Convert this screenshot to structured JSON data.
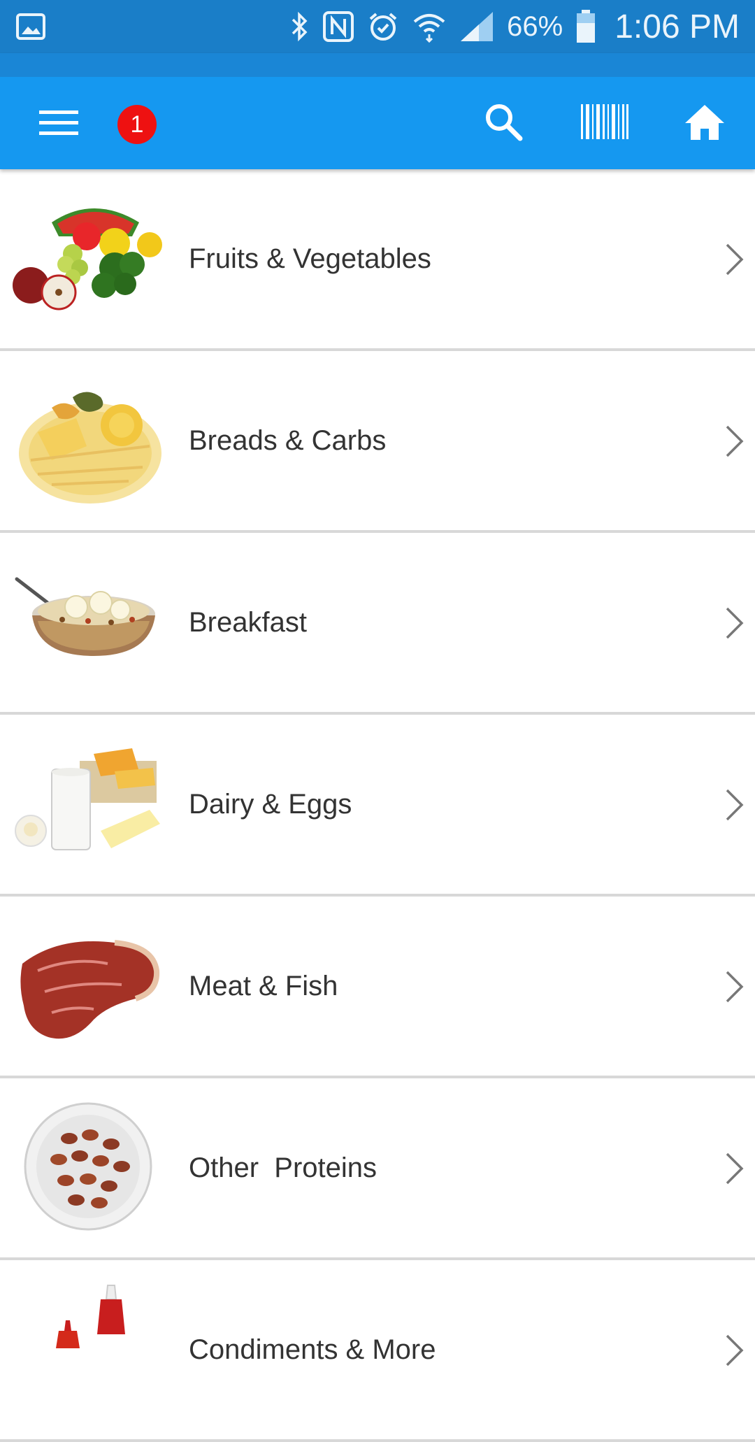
{
  "status_bar": {
    "battery": "66%",
    "time": "1:06 PM",
    "icons": [
      "gallery-icon",
      "bluetooth-icon",
      "nfc-icon",
      "alarm-icon",
      "wifi-icon",
      "signal-icon",
      "battery-icon"
    ]
  },
  "app_bar": {
    "notification_count": "1",
    "icons": [
      "menu-icon",
      "search-icon",
      "barcode-icon",
      "home-icon"
    ],
    "color": "#1598f0"
  },
  "categories": [
    {
      "label": "Fruits & Vegetables",
      "icon": "fruits-vegetables-image"
    },
    {
      "label": "Breads & Carbs",
      "icon": "breads-carbs-image"
    },
    {
      "label": "Breakfast",
      "icon": "breakfast-image"
    },
    {
      "label": "Dairy & Eggs",
      "icon": "dairy-eggs-image"
    },
    {
      "label": "Meat & Fish",
      "icon": "meat-fish-image"
    },
    {
      "label": "Other  Proteins",
      "icon": "other-proteins-image"
    },
    {
      "label": "Condiments & More",
      "icon": "condiments-image"
    }
  ]
}
